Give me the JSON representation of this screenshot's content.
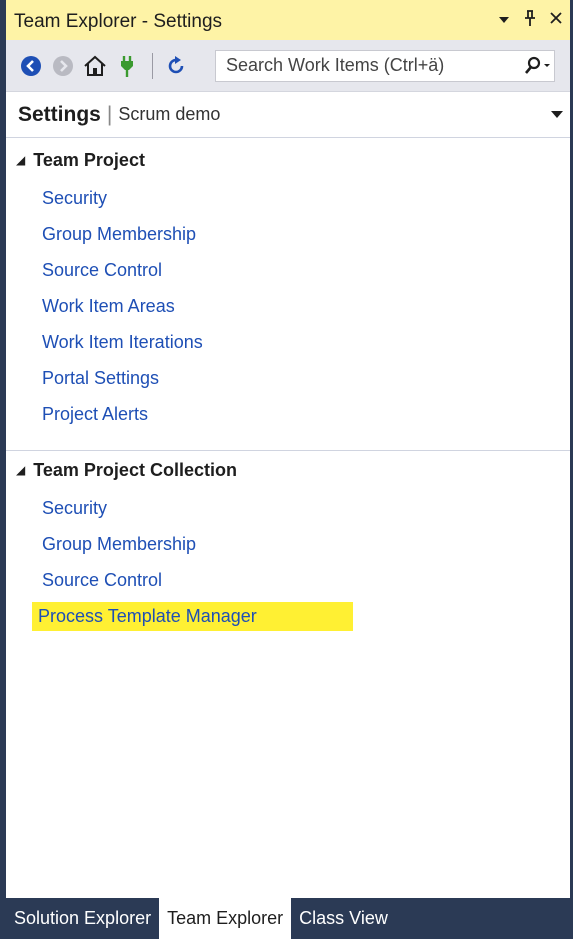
{
  "window": {
    "title": "Team Explorer - Settings",
    "controls": [
      "dropdown-icon",
      "pin-icon",
      "close-icon"
    ]
  },
  "toolbar": {
    "buttons": [
      "back-icon",
      "forward-icon",
      "home-icon",
      "connect-icon",
      "refresh-icon"
    ],
    "search_placeholder": "Search Work Items (Ctrl+ä)"
  },
  "header": {
    "title": "Settings",
    "separator": "|",
    "subtitle": "Scrum demo"
  },
  "sections": [
    {
      "title": "Team Project",
      "links": [
        "Security",
        "Group Membership",
        "Source Control",
        "Work Item Areas",
        "Work Item Iterations",
        "Portal Settings",
        "Project Alerts"
      ]
    },
    {
      "title": "Team Project Collection",
      "links": [
        "Security",
        "Group Membership",
        "Source Control",
        "Process Template Manager"
      ]
    }
  ],
  "highlight": {
    "item": "Process Template Manager",
    "color": "#fff033"
  },
  "tabs": [
    {
      "label": "Solution Explorer",
      "active": false
    },
    {
      "label": "Team Explorer",
      "active": true
    },
    {
      "label": "Class View",
      "active": false
    }
  ],
  "colors": {
    "title_bar": "#fef3a6",
    "toolbar": "#e6e7ed",
    "link": "#1e4fb5",
    "frame": "#2b3a55",
    "back_button": "#1e4fb5",
    "connect_icon": "#3a9a2f"
  }
}
